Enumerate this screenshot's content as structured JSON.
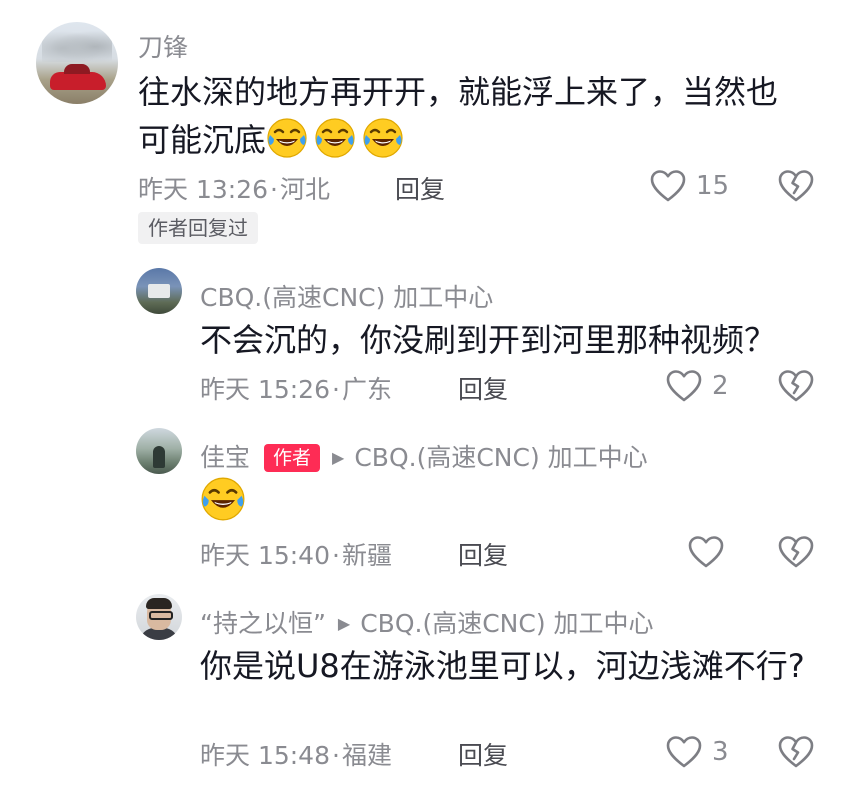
{
  "comment": {
    "author": "刀锋",
    "text": "往水深的地方再开开，就能浮上来了，当然也可能沉底",
    "emojis": [
      "laugh-cry-emoji",
      "laugh-cry-emoji",
      "laugh-cry-emoji"
    ],
    "time": "昨天 13:26",
    "location": "河北",
    "reply_label": "回复",
    "likes": "15",
    "author_replied_tag": "作者回复过"
  },
  "replies": [
    {
      "author": "CBQ.(高速CNC) 加工中心",
      "text": "不会沉的，你没刷到开到河里那种视频？",
      "time": "昨天 15:26",
      "location": "广东",
      "reply_label": "回复",
      "likes": "2"
    },
    {
      "author": "佳宝",
      "author_tag": "作者",
      "reply_to": "CBQ.(高速CNC) 加工中心",
      "emoji": "laugh-cry-emoji",
      "time": "昨天 15:40",
      "location": "新疆",
      "reply_label": "回复",
      "likes": ""
    },
    {
      "author": "“持之以恒”",
      "reply_to": "CBQ.(高速CNC) 加工中心",
      "text": "你是说U8在游泳池里可以，河边浅滩不行?",
      "time": "昨天 15:48",
      "location": "福建",
      "reply_label": "回复",
      "likes": "3"
    }
  ],
  "separator": "·",
  "colors": {
    "accent": "#fe2c55",
    "muted": "#8a8b91",
    "text": "#161823"
  }
}
